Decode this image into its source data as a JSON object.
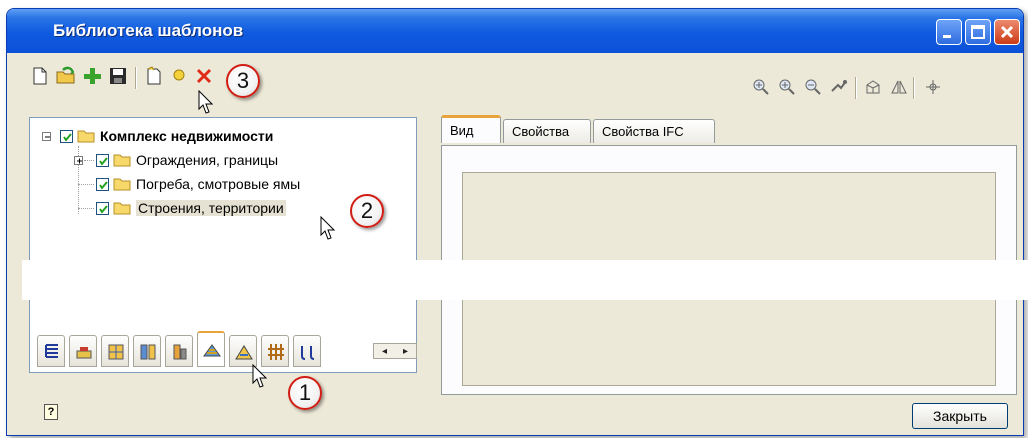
{
  "window": {
    "title": "Библиотека шаблонов"
  },
  "tree": {
    "root": {
      "label": "Комплекс недвижимости",
      "expanded": true,
      "checked": true
    },
    "items": [
      {
        "label": "Ограждения, границы",
        "checked": true,
        "expandable": true
      },
      {
        "label": "Погреба, смотровые ямы",
        "checked": true
      },
      {
        "label": "Строения, территории",
        "checked": true,
        "highlighted": true
      }
    ]
  },
  "tabs": [
    {
      "label": "Вид",
      "active": true
    },
    {
      "label": "Свойства"
    },
    {
      "label": "Свойства IFC"
    }
  ],
  "bottom_tabs": {
    "active_index": 5,
    "scroll_left": "◂",
    "scroll_right": "▸"
  },
  "buttons": {
    "close": "Закрыть",
    "help": "?"
  },
  "callouts": {
    "one": "1",
    "two": "2",
    "three": "3"
  },
  "colors": {
    "titlebar": "#0f5ae0",
    "tab_accent": "#e8a33b",
    "callout_border": "#d21d14",
    "window_bg": "#ece9d8"
  }
}
